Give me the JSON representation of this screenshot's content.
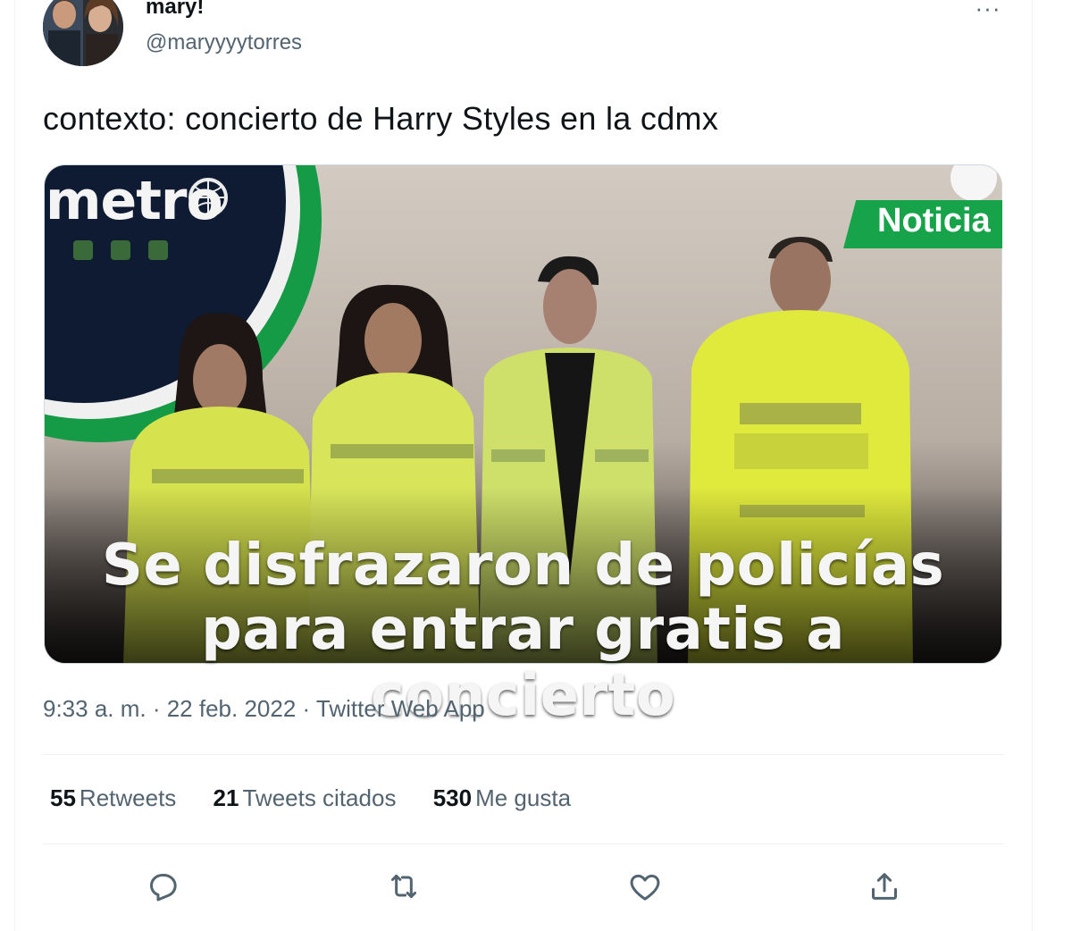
{
  "author": {
    "display_name": "mary!",
    "handle": "@maryyyytorres"
  },
  "more_label": "···",
  "tweet": {
    "text": "contexto: concierto de Harry Styles en la cdmx"
  },
  "media": {
    "logo_text": "metro",
    "badge_text": "Noticia",
    "caption_line1": "Se disfrazaron de policías",
    "caption_line2": "para entrar gratis a concierto"
  },
  "meta": {
    "line": "9:33 a. m. · 22 feb. 2022 · Twitter Web App"
  },
  "stats": [
    {
      "count": "55",
      "label": "Retweets"
    },
    {
      "count": "21",
      "label": "Tweets citados"
    },
    {
      "count": "530",
      "label": "Me gusta"
    }
  ],
  "actions": {
    "reply_icon": "reply-icon",
    "retweet_icon": "retweet-icon",
    "like_icon": "heart-icon",
    "share_icon": "share-icon"
  },
  "colors": {
    "text_primary": "#0f1419",
    "text_secondary": "#536471",
    "divider": "#eff3f4",
    "metro_green": "#17a34a"
  }
}
